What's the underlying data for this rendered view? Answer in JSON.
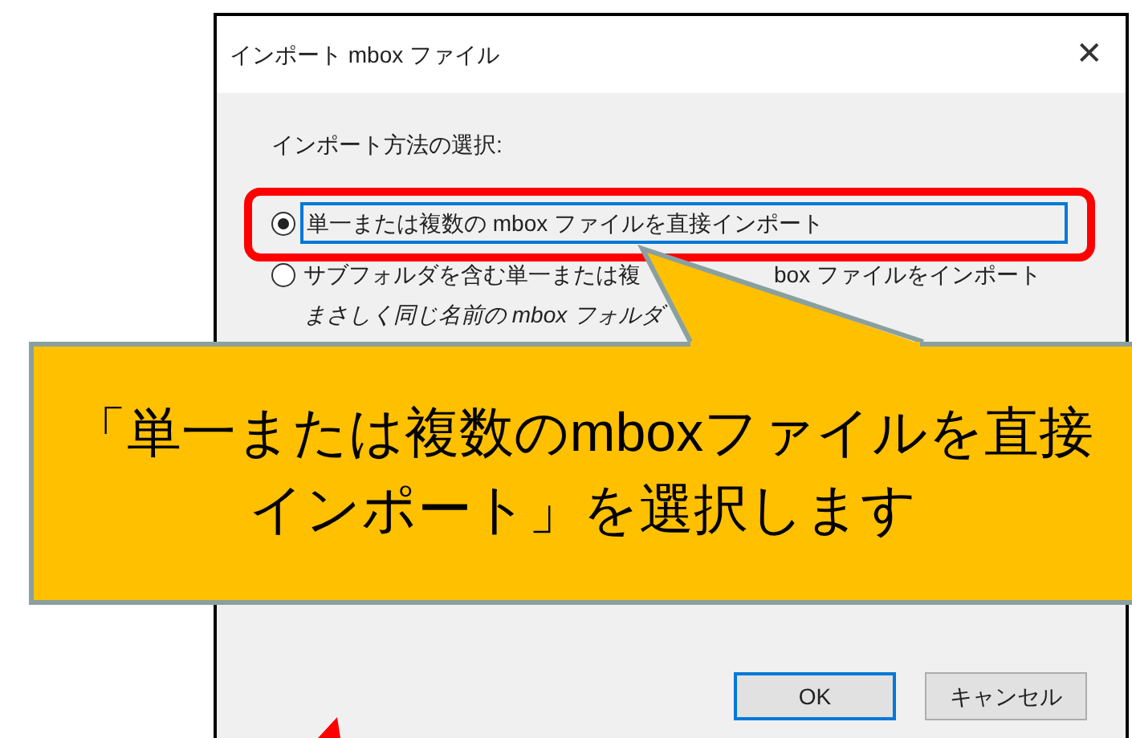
{
  "window": {
    "title": "インポート mbox ファイル",
    "close": "✕"
  },
  "prompt": "インポート方法の選択:",
  "options": [
    {
      "label_parts": [
        "単一または複数の mbox ファイルを直接インポート"
      ],
      "selected": true,
      "highlighted": true
    },
    {
      "label_parts": [
        "サブフォルダを含む単一または複",
        "box ファイルをインポート"
      ],
      "selected": false,
      "highlighted": false,
      "hint": "まさしく同じ名前の mbox フォルダ"
    }
  ],
  "callout": {
    "lines": [
      "「単一または複数のmboxファイルを直接",
      "インポート」を選択します"
    ]
  },
  "buttons": [
    {
      "label": "OK",
      "default": true
    },
    {
      "label": "キャンセル",
      "default": false
    }
  ]
}
